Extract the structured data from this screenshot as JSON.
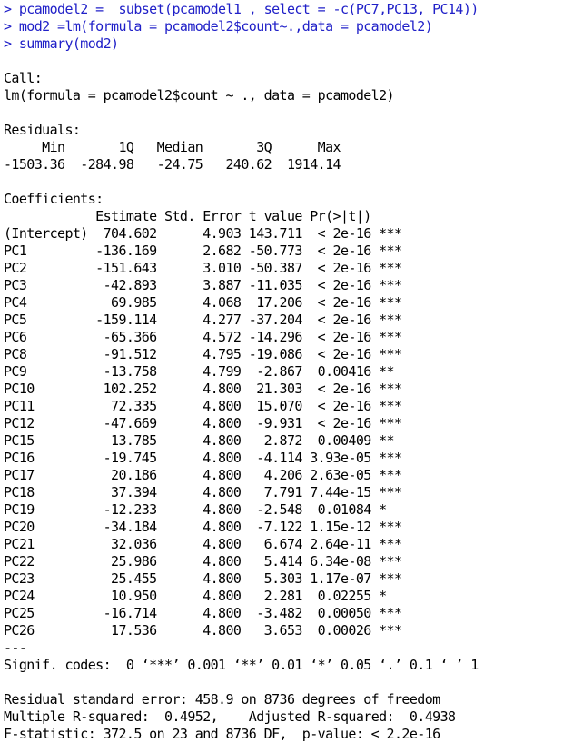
{
  "console": {
    "commands": [
      "> pcamodel2 =  subset(pcamodel1 , select = -c(PC7,PC13, PC14))",
      "> mod2 =lm(formula = pcamodel2$count~.,data = pcamodel2)",
      "> summary(mod2)"
    ],
    "call_header": "Call:",
    "call_text": "lm(formula = pcamodel2$count ~ ., data = pcamodel2)",
    "residuals_header": "Residuals:",
    "residuals_labels": "     Min       1Q   Median       3Q      Max ",
    "residuals_values": "-1503.36  -284.98   -24.75   240.62  1914.14 ",
    "coefficients_header": "Coefficients:",
    "coef_columns": "            Estimate Std. Error t value Pr(>|t|)    ",
    "coef_rows": [
      "(Intercept)  704.602      4.903 143.711  < 2e-16 ***",
      "PC1         -136.169      2.682 -50.773  < 2e-16 ***",
      "PC2         -151.643      3.010 -50.387  < 2e-16 ***",
      "PC3          -42.893      3.887 -11.035  < 2e-16 ***",
      "PC4           69.985      4.068  17.206  < 2e-16 ***",
      "PC5         -159.114      4.277 -37.204  < 2e-16 ***",
      "PC6          -65.366      4.572 -14.296  < 2e-16 ***",
      "PC8          -91.512      4.795 -19.086  < 2e-16 ***",
      "PC9          -13.758      4.799  -2.867  0.00416 ** ",
      "PC10         102.252      4.800  21.303  < 2e-16 ***",
      "PC11          72.335      4.800  15.070  < 2e-16 ***",
      "PC12         -47.669      4.800  -9.931  < 2e-16 ***",
      "PC15          13.785      4.800   2.872  0.00409 ** ",
      "PC16         -19.745      4.800  -4.114 3.93e-05 ***",
      "PC17          20.186      4.800   4.206 2.63e-05 ***",
      "PC18          37.394      4.800   7.791 7.44e-15 ***",
      "PC19         -12.233      4.800  -2.548  0.01084 *  ",
      "PC20         -34.184      4.800  -7.122 1.15e-12 ***",
      "PC21          32.036      4.800   6.674 2.64e-11 ***",
      "PC22          25.986      4.800   5.414 6.34e-08 ***",
      "PC23          25.455      4.800   5.303 1.17e-07 ***",
      "PC24          10.950      4.800   2.281  0.02255 *  ",
      "PC25         -16.714      4.800  -3.482  0.00050 ***",
      "PC26          17.536      4.800   3.653  0.00026 ***"
    ],
    "separator": "---",
    "signif_codes": "Signif. codes:  0 ‘***’ 0.001 ‘**’ 0.01 ‘*’ 0.05 ‘.’ 0.1 ‘ ’ 1",
    "residual_se": "Residual standard error: 458.9 on 8736 degrees of freedom",
    "r_squared": "Multiple R-squared:  0.4952,\tAdjusted R-squared:  0.4938 ",
    "f_statistic": "F-statistic: 372.5 on 23 and 8736 DF,  p-value: < 2.2e-16"
  },
  "colors": {
    "command_text": "#2020c8",
    "output_text": "#000000",
    "background": "#ffffff"
  }
}
